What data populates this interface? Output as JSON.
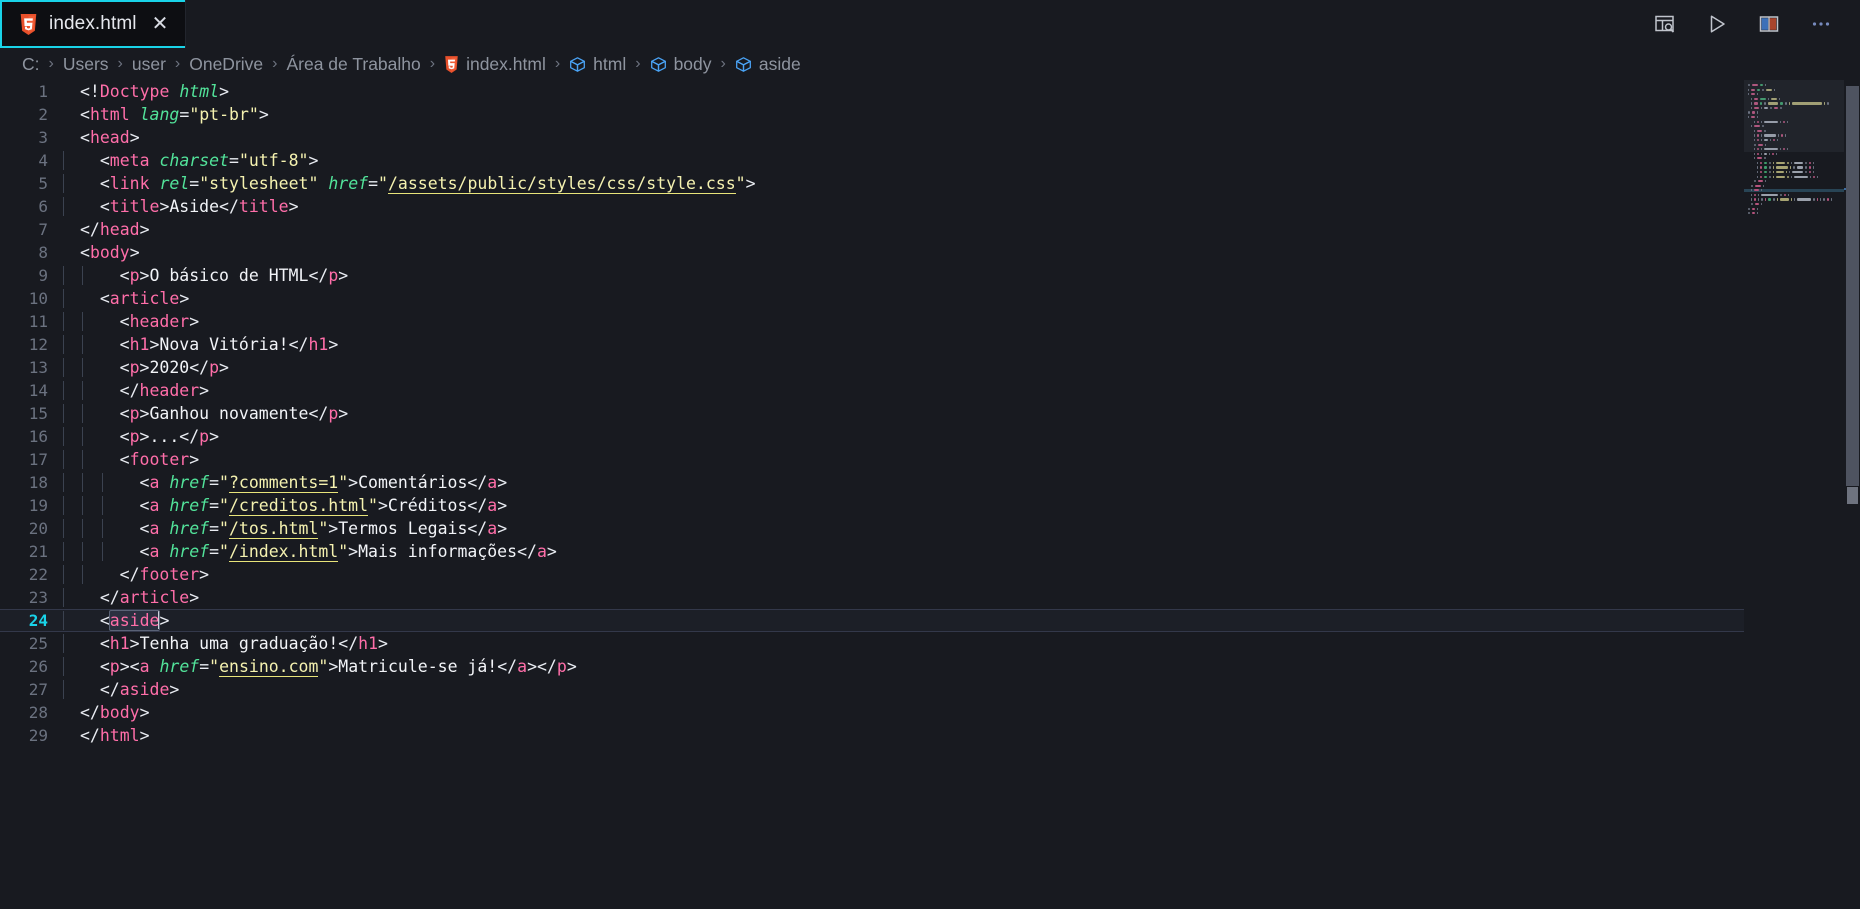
{
  "theme": {
    "editor_bg": "#181a20",
    "tab_active_bg": "#0d0e12",
    "accent": "#19d3e8",
    "tag_color": "#ff6ea9",
    "attr_color": "#52e39a",
    "string_color": "#f5f2b0",
    "text_color": "#e9ecf2",
    "linenum_color": "#6b7280",
    "active_linenum_color": "#19d3e8"
  },
  "tab": {
    "label": "index.html",
    "close_label": "✕",
    "icon": "html5-file-icon"
  },
  "toolbar": {
    "items": [
      {
        "name": "open-preview-icon",
        "title": "Open Preview to the Side"
      },
      {
        "name": "run-icon",
        "title": "Run"
      },
      {
        "name": "split-editor-icon",
        "title": "Split Editor"
      },
      {
        "name": "more-actions-icon",
        "title": "More Actions..."
      }
    ]
  },
  "breadcrumb": {
    "separator": "›",
    "items": [
      {
        "label": "C:",
        "icon": null
      },
      {
        "label": "Users",
        "icon": null
      },
      {
        "label": "user",
        "icon": null
      },
      {
        "label": "OneDrive",
        "icon": null
      },
      {
        "label": "Área de Trabalho",
        "icon": null
      },
      {
        "label": "index.html",
        "icon": "html5-file-icon"
      },
      {
        "label": "html",
        "icon": "symbol-cube-icon"
      },
      {
        "label": "body",
        "icon": "symbol-cube-icon"
      },
      {
        "label": "aside",
        "icon": "symbol-cube-icon"
      }
    ]
  },
  "editor": {
    "language": "html",
    "active_line": 24,
    "cursor_word": "aside",
    "first_line": 1,
    "last_line": 29,
    "lines": [
      {
        "n": 1,
        "indent": 0,
        "tokens": [
          {
            "t": "punc",
            "v": "<!"
          },
          {
            "t": "doctype",
            "v": "Doctype"
          },
          {
            "t": "text",
            "v": " "
          },
          {
            "t": "doctypeval",
            "v": "html"
          },
          {
            "t": "punc",
            "v": ">"
          }
        ]
      },
      {
        "n": 2,
        "indent": 0,
        "tokens": [
          {
            "t": "punc",
            "v": "<"
          },
          {
            "t": "tag",
            "v": "html"
          },
          {
            "t": "text",
            "v": " "
          },
          {
            "t": "attr",
            "v": "lang"
          },
          {
            "t": "punc",
            "v": "="
          },
          {
            "t": "str",
            "v": "\"pt-br\""
          },
          {
            "t": "punc",
            "v": ">"
          }
        ]
      },
      {
        "n": 3,
        "indent": 0,
        "tokens": [
          {
            "t": "punc",
            "v": "<"
          },
          {
            "t": "tag",
            "v": "head"
          },
          {
            "t": "punc",
            "v": ">"
          }
        ]
      },
      {
        "n": 4,
        "indent": 1,
        "tokens": [
          {
            "t": "punc",
            "v": "<"
          },
          {
            "t": "tag",
            "v": "meta"
          },
          {
            "t": "text",
            "v": " "
          },
          {
            "t": "attr",
            "v": "charset"
          },
          {
            "t": "punc",
            "v": "="
          },
          {
            "t": "str",
            "v": "\"utf-8\""
          },
          {
            "t": "punc",
            "v": ">"
          }
        ]
      },
      {
        "n": 5,
        "indent": 1,
        "tokens": [
          {
            "t": "punc",
            "v": "<"
          },
          {
            "t": "tag",
            "v": "link"
          },
          {
            "t": "text",
            "v": " "
          },
          {
            "t": "attr",
            "v": "rel"
          },
          {
            "t": "punc",
            "v": "="
          },
          {
            "t": "str",
            "v": "\"stylesheet\""
          },
          {
            "t": "text",
            "v": " "
          },
          {
            "t": "attr",
            "v": "href"
          },
          {
            "t": "punc",
            "v": "="
          },
          {
            "t": "str",
            "v": "\""
          },
          {
            "t": "link",
            "v": "/assets/public/styles/css/style.css"
          },
          {
            "t": "str",
            "v": "\""
          },
          {
            "t": "punc",
            "v": ">"
          }
        ]
      },
      {
        "n": 6,
        "indent": 1,
        "tokens": [
          {
            "t": "punc",
            "v": "<"
          },
          {
            "t": "tag",
            "v": "title"
          },
          {
            "t": "punc",
            "v": ">"
          },
          {
            "t": "text",
            "v": "Aside"
          },
          {
            "t": "punc",
            "v": "</"
          },
          {
            "t": "tag",
            "v": "title"
          },
          {
            "t": "punc",
            "v": ">"
          }
        ]
      },
      {
        "n": 7,
        "indent": 0,
        "tokens": [
          {
            "t": "punc",
            "v": "</"
          },
          {
            "t": "tag",
            "v": "head"
          },
          {
            "t": "punc",
            "v": ">"
          }
        ]
      },
      {
        "n": 8,
        "indent": 0,
        "tokens": [
          {
            "t": "punc",
            "v": "<"
          },
          {
            "t": "tag",
            "v": "body"
          },
          {
            "t": "punc",
            "v": ">"
          }
        ]
      },
      {
        "n": 9,
        "indent": 2,
        "tokens": [
          {
            "t": "punc",
            "v": "<"
          },
          {
            "t": "tag",
            "v": "p"
          },
          {
            "t": "punc",
            "v": ">"
          },
          {
            "t": "text",
            "v": "O básico de HTML"
          },
          {
            "t": "punc",
            "v": "</"
          },
          {
            "t": "tag",
            "v": "p"
          },
          {
            "t": "punc",
            "v": ">"
          }
        ]
      },
      {
        "n": 10,
        "indent": 1,
        "tokens": [
          {
            "t": "punc",
            "v": "<"
          },
          {
            "t": "tag",
            "v": "article"
          },
          {
            "t": "punc",
            "v": ">"
          }
        ]
      },
      {
        "n": 11,
        "indent": 2,
        "tokens": [
          {
            "t": "punc",
            "v": "<"
          },
          {
            "t": "tag",
            "v": "header"
          },
          {
            "t": "punc",
            "v": ">"
          }
        ]
      },
      {
        "n": 12,
        "indent": 2,
        "tokens": [
          {
            "t": "punc",
            "v": "<"
          },
          {
            "t": "tag",
            "v": "h1"
          },
          {
            "t": "punc",
            "v": ">"
          },
          {
            "t": "text",
            "v": "Nova Vitória!"
          },
          {
            "t": "punc",
            "v": "</"
          },
          {
            "t": "tag",
            "v": "h1"
          },
          {
            "t": "punc",
            "v": ">"
          }
        ]
      },
      {
        "n": 13,
        "indent": 2,
        "tokens": [
          {
            "t": "punc",
            "v": "<"
          },
          {
            "t": "tag",
            "v": "p"
          },
          {
            "t": "punc",
            "v": ">"
          },
          {
            "t": "text",
            "v": "2020"
          },
          {
            "t": "punc",
            "v": "</"
          },
          {
            "t": "tag",
            "v": "p"
          },
          {
            "t": "punc",
            "v": ">"
          }
        ]
      },
      {
        "n": 14,
        "indent": 2,
        "tokens": [
          {
            "t": "punc",
            "v": "</"
          },
          {
            "t": "tag",
            "v": "header"
          },
          {
            "t": "punc",
            "v": ">"
          }
        ]
      },
      {
        "n": 15,
        "indent": 2,
        "tokens": [
          {
            "t": "punc",
            "v": "<"
          },
          {
            "t": "tag",
            "v": "p"
          },
          {
            "t": "punc",
            "v": ">"
          },
          {
            "t": "text",
            "v": "Ganhou novamente"
          },
          {
            "t": "punc",
            "v": "</"
          },
          {
            "t": "tag",
            "v": "p"
          },
          {
            "t": "punc",
            "v": ">"
          }
        ]
      },
      {
        "n": 16,
        "indent": 2,
        "tokens": [
          {
            "t": "punc",
            "v": "<"
          },
          {
            "t": "tag",
            "v": "p"
          },
          {
            "t": "punc",
            "v": ">"
          },
          {
            "t": "text",
            "v": "..."
          },
          {
            "t": "punc",
            "v": "</"
          },
          {
            "t": "tag",
            "v": "p"
          },
          {
            "t": "punc",
            "v": ">"
          }
        ]
      },
      {
        "n": 17,
        "indent": 2,
        "tokens": [
          {
            "t": "punc",
            "v": "<"
          },
          {
            "t": "tag",
            "v": "footer"
          },
          {
            "t": "punc",
            "v": ">"
          }
        ]
      },
      {
        "n": 18,
        "indent": 3,
        "tokens": [
          {
            "t": "punc",
            "v": "<"
          },
          {
            "t": "tag",
            "v": "a"
          },
          {
            "t": "text",
            "v": " "
          },
          {
            "t": "attr",
            "v": "href"
          },
          {
            "t": "punc",
            "v": "="
          },
          {
            "t": "str",
            "v": "\""
          },
          {
            "t": "link",
            "v": "?comments=1"
          },
          {
            "t": "str",
            "v": "\""
          },
          {
            "t": "punc",
            "v": ">"
          },
          {
            "t": "text",
            "v": "Comentários"
          },
          {
            "t": "punc",
            "v": "</"
          },
          {
            "t": "tag",
            "v": "a"
          },
          {
            "t": "punc",
            "v": ">"
          }
        ]
      },
      {
        "n": 19,
        "indent": 3,
        "tokens": [
          {
            "t": "punc",
            "v": "<"
          },
          {
            "t": "tag",
            "v": "a"
          },
          {
            "t": "text",
            "v": " "
          },
          {
            "t": "attr",
            "v": "href"
          },
          {
            "t": "punc",
            "v": "="
          },
          {
            "t": "str",
            "v": "\""
          },
          {
            "t": "link",
            "v": "/creditos.html"
          },
          {
            "t": "str",
            "v": "\""
          },
          {
            "t": "punc",
            "v": ">"
          },
          {
            "t": "text",
            "v": "Créditos"
          },
          {
            "t": "punc",
            "v": "</"
          },
          {
            "t": "tag",
            "v": "a"
          },
          {
            "t": "punc",
            "v": ">"
          }
        ]
      },
      {
        "n": 20,
        "indent": 3,
        "tokens": [
          {
            "t": "punc",
            "v": "<"
          },
          {
            "t": "tag",
            "v": "a"
          },
          {
            "t": "text",
            "v": " "
          },
          {
            "t": "attr",
            "v": "href"
          },
          {
            "t": "punc",
            "v": "="
          },
          {
            "t": "str",
            "v": "\""
          },
          {
            "t": "link",
            "v": "/tos.html"
          },
          {
            "t": "str",
            "v": "\""
          },
          {
            "t": "punc",
            "v": ">"
          },
          {
            "t": "text",
            "v": "Termos Legais"
          },
          {
            "t": "punc",
            "v": "</"
          },
          {
            "t": "tag",
            "v": "a"
          },
          {
            "t": "punc",
            "v": ">"
          }
        ]
      },
      {
        "n": 21,
        "indent": 3,
        "tokens": [
          {
            "t": "punc",
            "v": "<"
          },
          {
            "t": "tag",
            "v": "a"
          },
          {
            "t": "text",
            "v": " "
          },
          {
            "t": "attr",
            "v": "href"
          },
          {
            "t": "punc",
            "v": "="
          },
          {
            "t": "str",
            "v": "\""
          },
          {
            "t": "link",
            "v": "/index.html"
          },
          {
            "t": "str",
            "v": "\""
          },
          {
            "t": "punc",
            "v": ">"
          },
          {
            "t": "text",
            "v": "Mais informações"
          },
          {
            "t": "punc",
            "v": "</"
          },
          {
            "t": "tag",
            "v": "a"
          },
          {
            "t": "punc",
            "v": ">"
          }
        ]
      },
      {
        "n": 22,
        "indent": 2,
        "tokens": [
          {
            "t": "punc",
            "v": "</"
          },
          {
            "t": "tag",
            "v": "footer"
          },
          {
            "t": "punc",
            "v": ">"
          }
        ]
      },
      {
        "n": 23,
        "indent": 1,
        "tokens": [
          {
            "t": "punc",
            "v": "</"
          },
          {
            "t": "tag",
            "v": "article"
          },
          {
            "t": "punc",
            "v": ">"
          }
        ]
      },
      {
        "n": 24,
        "indent": 1,
        "active": true,
        "tokens": [
          {
            "t": "punc",
            "v": "<"
          },
          {
            "t": "tag",
            "v": "aside",
            "match": true
          },
          {
            "t": "punc",
            "v": ">"
          }
        ]
      },
      {
        "n": 25,
        "indent": 1,
        "tokens": [
          {
            "t": "punc",
            "v": "<"
          },
          {
            "t": "tag",
            "v": "h1"
          },
          {
            "t": "punc",
            "v": ">"
          },
          {
            "t": "text",
            "v": "Tenha uma graduação!"
          },
          {
            "t": "punc",
            "v": "</"
          },
          {
            "t": "tag",
            "v": "h1"
          },
          {
            "t": "punc",
            "v": ">"
          }
        ]
      },
      {
        "n": 26,
        "indent": 1,
        "tokens": [
          {
            "t": "punc",
            "v": "<"
          },
          {
            "t": "tag",
            "v": "p"
          },
          {
            "t": "punc",
            "v": ">"
          },
          {
            "t": "punc",
            "v": "<"
          },
          {
            "t": "tag",
            "v": "a"
          },
          {
            "t": "text",
            "v": " "
          },
          {
            "t": "attr",
            "v": "href"
          },
          {
            "t": "punc",
            "v": "="
          },
          {
            "t": "str",
            "v": "\""
          },
          {
            "t": "link",
            "v": "ensino.com"
          },
          {
            "t": "str",
            "v": "\""
          },
          {
            "t": "punc",
            "v": ">"
          },
          {
            "t": "text",
            "v": "Matricule-se já!"
          },
          {
            "t": "punc",
            "v": "</"
          },
          {
            "t": "tag",
            "v": "a"
          },
          {
            "t": "punc",
            "v": ">"
          },
          {
            "t": "punc",
            "v": "</"
          },
          {
            "t": "tag",
            "v": "p"
          },
          {
            "t": "punc",
            "v": ">"
          }
        ]
      },
      {
        "n": 27,
        "indent": 1,
        "tokens": [
          {
            "t": "punc",
            "v": "</"
          },
          {
            "t": "tag",
            "v": "aside"
          },
          {
            "t": "punc",
            "v": ">"
          }
        ]
      },
      {
        "n": 28,
        "indent": 0,
        "tokens": [
          {
            "t": "punc",
            "v": "</"
          },
          {
            "t": "tag",
            "v": "body"
          },
          {
            "t": "punc",
            "v": ">"
          }
        ]
      },
      {
        "n": 29,
        "indent": 0,
        "tokens": [
          {
            "t": "punc",
            "v": "</"
          },
          {
            "t": "tag",
            "v": "html"
          },
          {
            "t": "punc",
            "v": ">"
          }
        ]
      }
    ]
  },
  "minimap": {
    "visible": true
  },
  "scrollbar": {
    "visible": true
  }
}
